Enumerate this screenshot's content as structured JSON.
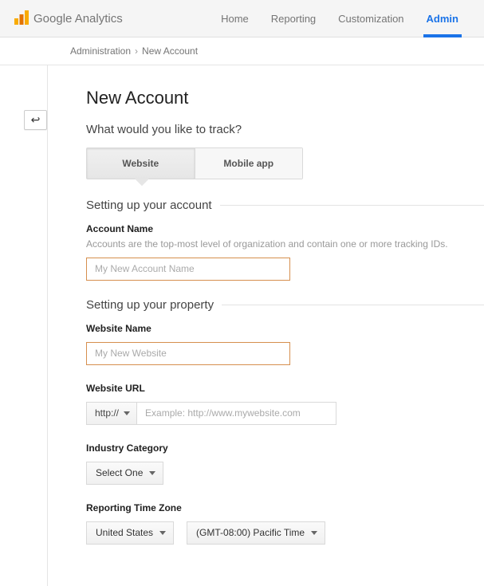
{
  "brand": "Google Analytics",
  "nav": {
    "home": "Home",
    "reporting": "Reporting",
    "customization": "Customization",
    "admin": "Admin"
  },
  "breadcrumb": {
    "root": "Administration",
    "current": "New Account"
  },
  "page": {
    "title": "New Account",
    "track_question": "What would you like to track?"
  },
  "tabs": {
    "website": "Website",
    "mobile": "Mobile app"
  },
  "sections": {
    "account": "Setting up your account",
    "property": "Setting up your property"
  },
  "account": {
    "name_label": "Account Name",
    "name_help": "Accounts are the top-most level of organization and contain one or more tracking IDs.",
    "name_placeholder": "My New Account Name"
  },
  "property": {
    "site_name_label": "Website Name",
    "site_name_placeholder": "My New Website",
    "url_label": "Website URL",
    "protocol": "http://",
    "url_placeholder": "Example: http://www.mywebsite.com",
    "industry_label": "Industry Category",
    "industry_value": "Select One",
    "tz_label": "Reporting Time Zone",
    "tz_country": "United States",
    "tz_value": "(GMT-08:00) Pacific Time"
  }
}
